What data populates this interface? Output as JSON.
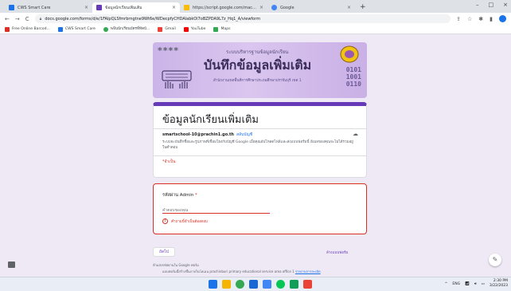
{
  "browser": {
    "tabs": [
      {
        "label": "CWS Smart Care",
        "color": "#1a73e8",
        "active": false
      },
      {
        "label": "ข้อมูลนักเรียนเพิ่มเติม",
        "color": "#673ab7",
        "active": true
      },
      {
        "label": "https://script.google.com/macros",
        "color": "#fbbc04",
        "active": false
      },
      {
        "label": "Google",
        "color": "#4285f4",
        "active": false
      }
    ],
    "new_tab": "+",
    "window_controls": {
      "minimize": "–",
      "maximize": "□",
      "close": "×"
    },
    "url": "docs.google.com/forms/d/e/1FAIpQLSfmrbrngtne9Wt6e/WDecpfyCHDAlabkOl7oBZPDA9L7z_Hq1_A/viewform",
    "bookmarks": [
      {
        "label": "Free Online Barcod...",
        "color": "#d93025"
      },
      {
        "label": "CWS Smart Care",
        "color": "#1a73e8"
      },
      {
        "label": "พจีนนักเรียนบัตรที่ทัดบ้...",
        "color": "#34a853"
      },
      {
        "label": "Gmail",
        "color": "#ea4335"
      },
      {
        "label": "YouTube",
        "color": "#ff0000"
      },
      {
        "label": "Maps",
        "color": "#34a853"
      }
    ]
  },
  "banner": {
    "stars": "****",
    "subtitle_top": "ระบบบริหารฐานข้อมูลนักเรียน",
    "main": "บันทึกข้อมูลเพิ่มเติม",
    "subtitle_bottom": "สำนักงานเขตพื้นที่การศึกษาประถมศึกษาปราจีนบุรี เขต 1",
    "digits": [
      "0101",
      "1001",
      "0110"
    ]
  },
  "form": {
    "title": "ข้อมูลนักเรียนเพิ่มเติม",
    "email": "smartschool-10@prachin1.go.th",
    "switch_account": "สลับบัญชี",
    "note": "ระบบจะบันทึกชื่อและรูปภาพที่เชื่อมโยงกับบัญชี Google เมื่อคุณอัปโหลดไฟล์และส่งแบบฟอร์มนี้ อีเมลของคุณจะไม่ได้รวมอยู่ในคำตอบ",
    "required_note": "*จำเป็น",
    "question": {
      "label": "รหัสผ่าน Admin",
      "required_mark": "*",
      "placeholder": "คำตอบของคุณ",
      "error": "คำถามนี้จำเป็นต้องตอบ"
    },
    "next_button": "ถัดไป",
    "clear_form": "ล้างแบบฟอร์ม",
    "footer_warning": "ห้ามส่งรหัสผ่านใน Google ฟอร์ม",
    "footer_credit": "แบบฟอร์มนี้สร้างขึ้นภายในโดเมน prachinburi primary educational service area office 1",
    "footer_report": "รายงานการละเมิด"
  },
  "taskbar": {
    "apps": [
      {
        "name": "start",
        "color": "#1a73e8"
      },
      {
        "name": "file-explorer",
        "color": "#f4b400"
      },
      {
        "name": "chrome",
        "color": "#34a853"
      },
      {
        "name": "store",
        "color": "#1967d2"
      },
      {
        "name": "photos",
        "color": "#4285f4"
      },
      {
        "name": "line",
        "color": "#06c755"
      },
      {
        "name": "calendar",
        "color": "#0f9d58"
      },
      {
        "name": "maps",
        "color": "#ea4335"
      }
    ],
    "lang": "ENG",
    "time": "2:30 PM",
    "date": "3/22/2023"
  }
}
